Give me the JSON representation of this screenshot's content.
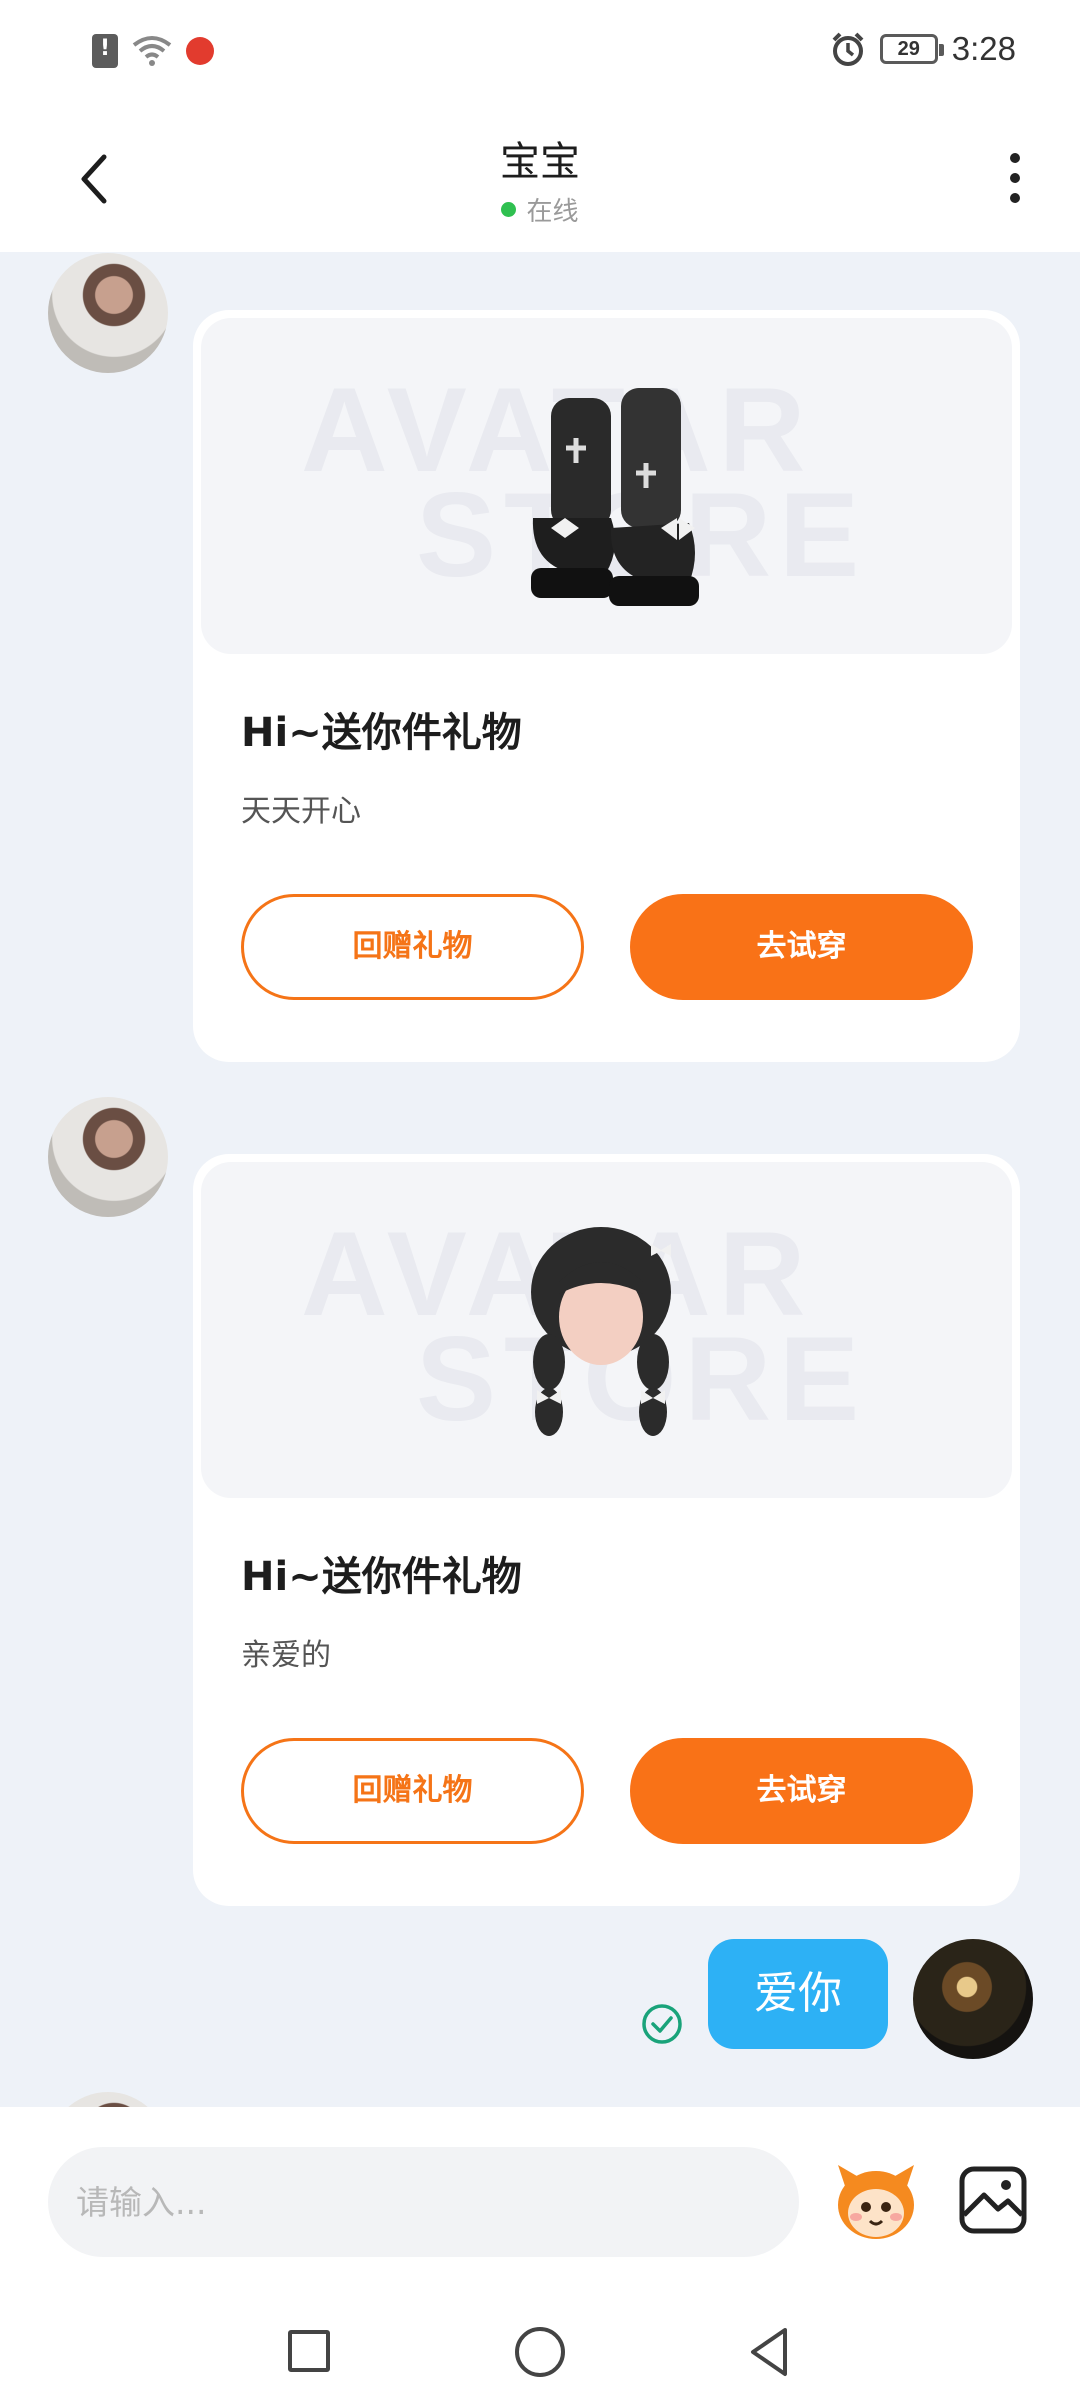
{
  "status_bar": {
    "time": "3:28",
    "battery": "29",
    "icons": [
      "sim-alert-icon",
      "wifi-icon",
      "app-notification-icon",
      "alarm-icon",
      "battery-icon"
    ]
  },
  "header": {
    "title": "宝宝",
    "status": "在线",
    "status_color": "#2fc050",
    "back_icon": "chevron-left-icon",
    "more_icon": "more-vertical-icon"
  },
  "messages": [
    {
      "from": "friend",
      "type": "gift",
      "item": "boots",
      "title": "Hi~送你件礼物",
      "subtitle": "天天开心",
      "return_label": "回赠礼物",
      "try_label": "去试穿"
    },
    {
      "from": "friend",
      "type": "gift",
      "item": "braided-hair",
      "title": "Hi~送你件礼物",
      "subtitle": "亲爱的",
      "return_label": "回赠礼物",
      "try_label": "去试穿"
    },
    {
      "from": "me",
      "type": "text",
      "text": "爱你",
      "status_icon": "read-check-icon"
    }
  ],
  "watermark": [
    "AVATAR",
    "STORE"
  ],
  "input": {
    "placeholder": "请输入..."
  },
  "colors": {
    "accent_orange": "#f97217",
    "bubble_blue": "#2db1f5",
    "background": "#eef2f8"
  }
}
